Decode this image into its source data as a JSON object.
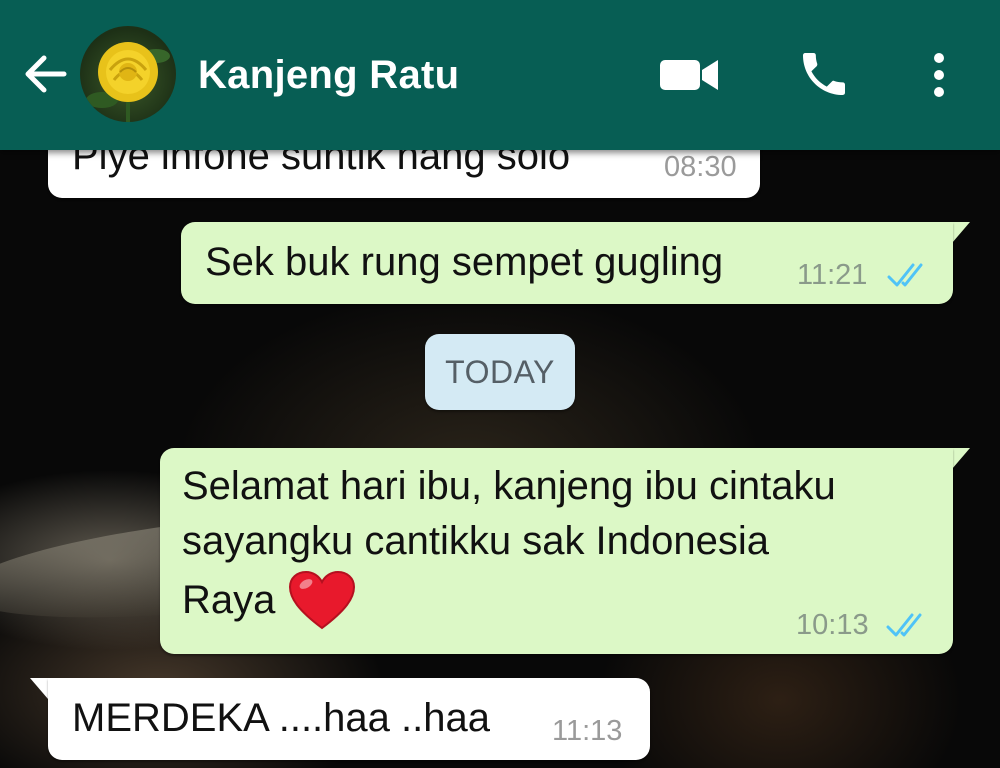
{
  "header": {
    "contact_name": "Kanjeng Ratu",
    "back_icon": "arrow-left-icon",
    "avatar_icon": "yellow-rose-avatar",
    "actions": [
      "video-camera-icon",
      "phone-icon",
      "more-vert-icon"
    ],
    "bar_color": "#075e54"
  },
  "messages": [
    {
      "direction": "incoming",
      "text": "Piye infone suntik nang solo",
      "time": "08:30"
    },
    {
      "direction": "outgoing",
      "text": "Sek buk rung sempet gugling",
      "time": "11:21",
      "status": "read"
    },
    {
      "direction": "outgoing",
      "text": "Selamat hari ibu, kanjeng ibu cintaku sayangku cantikku sak Indonesia Raya",
      "text_lines": [
        "Selamat hari ibu, kanjeng ibu cintaku",
        "sayangku cantikku sak Indonesia",
        "Raya"
      ],
      "emoji": "red-heart",
      "time": "10:13",
      "status": "read"
    },
    {
      "direction": "incoming",
      "text": "MERDEKA ....haa ..haa",
      "time": "11:13"
    }
  ],
  "day_separator": "TODAY",
  "colors": {
    "outgoing_bubble": "#dcf8c6",
    "incoming_bubble": "#ffffff",
    "read_ticks": "#4fc3f7",
    "day_chip": "#d4eaf4"
  }
}
